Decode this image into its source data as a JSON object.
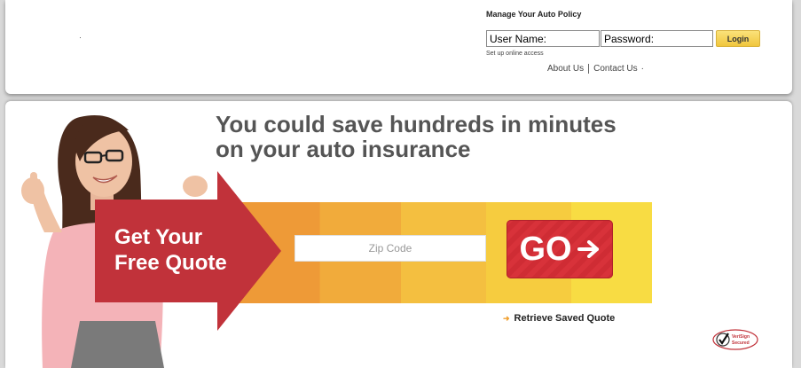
{
  "header": {
    "manage_title": "Manage Your Auto Policy",
    "username_placeholder": "User Name:",
    "password_placeholder": "Password:",
    "login_label": "Login",
    "setup_link": "Set up online access",
    "links": [
      "About Us",
      "Contact Us"
    ],
    "trailing_mark": "·"
  },
  "hero": {
    "headline_line1": "You could save hundreds in minutes",
    "headline_line2": "on your auto insurance",
    "arrow_line1": "Get Your",
    "arrow_line2": "Free Quote",
    "zip_placeholder": "Zip Code",
    "go_label": "GO",
    "retrieve_label": "Retrieve Saved Quote",
    "seal_text": [
      "VeriSign",
      "Secured"
    ]
  },
  "icons": {
    "go_arrow": "arrow-right-icon",
    "retrieve_arrow": "arrow-right-icon",
    "seal": "verisign-checkmark-icon"
  },
  "colors": {
    "accent_red": "#cf2c34",
    "banner_orange": "#ee9a37",
    "banner_yellow": "#f8dc43",
    "login_yellow": "#f0c63d",
    "headline_gray": "#555555"
  }
}
